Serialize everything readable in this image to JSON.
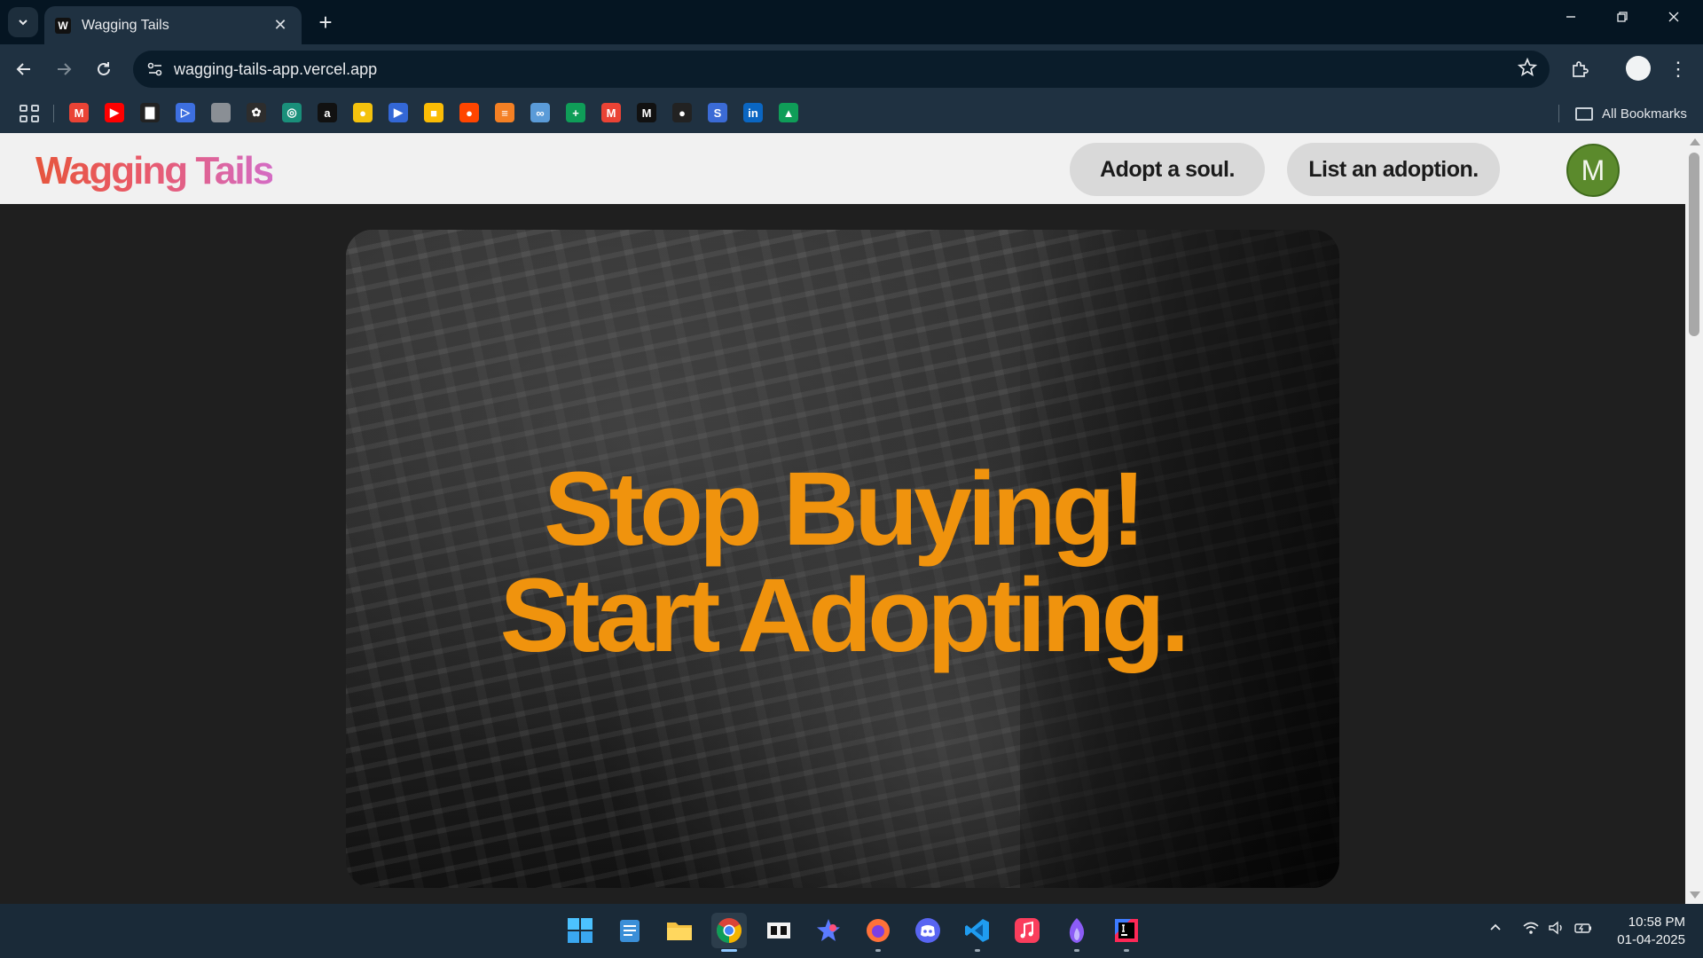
{
  "browser": {
    "tab_title": "Wagging Tails",
    "tab_favicon_letter": "W",
    "url": "wagging-tails-app.vercel.app",
    "all_bookmarks_label": "All Bookmarks",
    "bookmarks": [
      {
        "name": "gmail",
        "glyph": "M",
        "color": "#ea4335"
      },
      {
        "name": "youtube",
        "glyph": "▶",
        "color": "#ff0000"
      },
      {
        "name": "app-3",
        "glyph": "▇",
        "color": "#222222"
      },
      {
        "name": "app-4",
        "glyph": "▷",
        "color": "#3d6fe0"
      },
      {
        "name": "apple",
        "glyph": "",
        "color": "#8a8f95"
      },
      {
        "name": "openai",
        "glyph": "✿",
        "color": "#2d2d2d"
      },
      {
        "name": "app-7",
        "glyph": "◎",
        "color": "#1a8f7a"
      },
      {
        "name": "amazon",
        "glyph": "a",
        "color": "#111111"
      },
      {
        "name": "app-9",
        "glyph": "●",
        "color": "#f4c20d"
      },
      {
        "name": "app-10",
        "glyph": "▶",
        "color": "#3367d6"
      },
      {
        "name": "app-11",
        "glyph": "■",
        "color": "#fbbc05"
      },
      {
        "name": "reddit",
        "glyph": "●",
        "color": "#ff4500"
      },
      {
        "name": "app-13",
        "glyph": "≡",
        "color": "#f48024"
      },
      {
        "name": "app-14",
        "glyph": "∞",
        "color": "#5a9bd8"
      },
      {
        "name": "app-15",
        "glyph": "+",
        "color": "#0f9d58"
      },
      {
        "name": "gmail-2",
        "glyph": "M",
        "color": "#ea4335"
      },
      {
        "name": "app-17",
        "glyph": "M",
        "color": "#111111"
      },
      {
        "name": "github",
        "glyph": "●",
        "color": "#222222"
      },
      {
        "name": "app-19",
        "glyph": "S",
        "color": "#3b6bd6"
      },
      {
        "name": "linkedin",
        "glyph": "in",
        "color": "#0a66c2"
      },
      {
        "name": "google-drive",
        "glyph": "▲",
        "color": "#0f9d58"
      }
    ]
  },
  "site": {
    "logo": "Wagging Tails",
    "nav": {
      "adopt_label": "Adopt a soul.",
      "list_label": "List an adoption."
    },
    "avatar_letter": "M",
    "hero": {
      "line1": "Stop Buying!",
      "line2": "Start Adopting."
    }
  },
  "taskbar": {
    "apps": [
      "start",
      "notepad",
      "file-explorer",
      "chrome",
      "app-dl",
      "app-star",
      "firefox",
      "discord",
      "vscode",
      "itunes",
      "app-flame",
      "intellij"
    ],
    "clock_time": "10:58 PM",
    "clock_date": "01-04-2025"
  },
  "colors": {
    "hero_text": "#f0930d",
    "avatar": "#5b8a2c",
    "nav_pill": "#d9d9d9"
  }
}
